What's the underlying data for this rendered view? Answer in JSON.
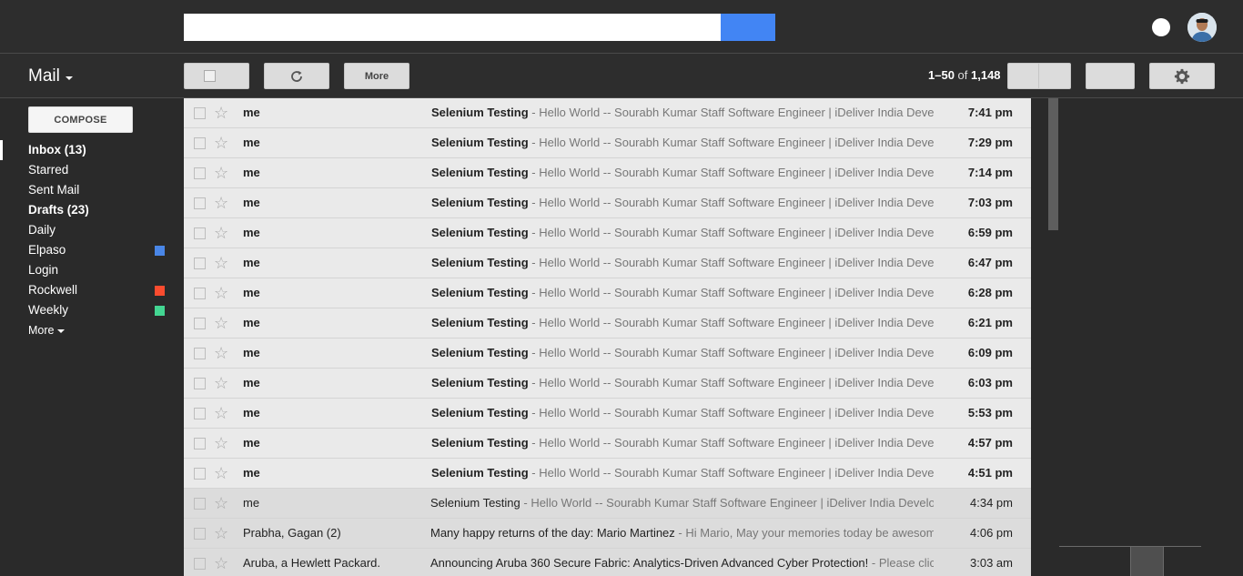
{
  "header": {
    "search_placeholder": "",
    "search_value": ""
  },
  "toolbar": {
    "mail_label": "Mail",
    "more_label": "More",
    "pager_range": "1–50",
    "pager_of": " of ",
    "pager_total": "1,148"
  },
  "sidebar": {
    "compose_label": "COMPOSE",
    "items": [
      {
        "label": "Inbox (13)",
        "bold": true,
        "active": true,
        "color": null
      },
      {
        "label": "Starred",
        "bold": false,
        "active": false,
        "color": null
      },
      {
        "label": "Sent Mail",
        "bold": false,
        "active": false,
        "color": null
      },
      {
        "label": "Drafts (23)",
        "bold": true,
        "active": false,
        "color": null
      },
      {
        "label": "Daily",
        "bold": false,
        "active": false,
        "color": null
      },
      {
        "label": "Elpaso",
        "bold": false,
        "active": false,
        "color": "#4986e7"
      },
      {
        "label": "Login",
        "bold": false,
        "active": false,
        "color": null
      },
      {
        "label": "Rockwell",
        "bold": false,
        "active": false,
        "color": "#fb4c2f"
      },
      {
        "label": "Weekly",
        "bold": false,
        "active": false,
        "color": "#43d692"
      }
    ],
    "more_label": "More"
  },
  "emails": [
    {
      "sender": "me",
      "subject": "Selenium Testing",
      "snippet": " - Hello World -- Sourabh Kumar Staff Software Engineer | iDeliver India Develo",
      "time": "7:41 pm",
      "unread": true
    },
    {
      "sender": "me",
      "subject": "Selenium Testing",
      "snippet": " - Hello World -- Sourabh Kumar Staff Software Engineer | iDeliver India Develo",
      "time": "7:29 pm",
      "unread": true
    },
    {
      "sender": "me",
      "subject": "Selenium Testing",
      "snippet": " - Hello World -- Sourabh Kumar Staff Software Engineer | iDeliver India Develo",
      "time": "7:14 pm",
      "unread": true
    },
    {
      "sender": "me",
      "subject": "Selenium Testing",
      "snippet": " - Hello World -- Sourabh Kumar Staff Software Engineer | iDeliver India Develo",
      "time": "7:03 pm",
      "unread": true
    },
    {
      "sender": "me",
      "subject": "Selenium Testing",
      "snippet": " - Hello World -- Sourabh Kumar Staff Software Engineer | iDeliver India Develo",
      "time": "6:59 pm",
      "unread": true
    },
    {
      "sender": "me",
      "subject": "Selenium Testing",
      "snippet": " - Hello World -- Sourabh Kumar Staff Software Engineer | iDeliver India Develo",
      "time": "6:47 pm",
      "unread": true
    },
    {
      "sender": "me",
      "subject": "Selenium Testing",
      "snippet": " - Hello World -- Sourabh Kumar Staff Software Engineer | iDeliver India Develo",
      "time": "6:28 pm",
      "unread": true
    },
    {
      "sender": "me",
      "subject": "Selenium Testing",
      "snippet": " - Hello World -- Sourabh Kumar Staff Software Engineer | iDeliver India Develo",
      "time": "6:21 pm",
      "unread": true
    },
    {
      "sender": "me",
      "subject": "Selenium Testing",
      "snippet": " - Hello World -- Sourabh Kumar Staff Software Engineer | iDeliver India Develo",
      "time": "6:09 pm",
      "unread": true
    },
    {
      "sender": "me",
      "subject": "Selenium Testing",
      "snippet": " - Hello World -- Sourabh Kumar Staff Software Engineer | iDeliver India Develo",
      "time": "6:03 pm",
      "unread": true
    },
    {
      "sender": "me",
      "subject": "Selenium Testing",
      "snippet": " - Hello World -- Sourabh Kumar Staff Software Engineer | iDeliver India Develo",
      "time": "5:53 pm",
      "unread": true
    },
    {
      "sender": "me",
      "subject": "Selenium Testing",
      "snippet": " - Hello World -- Sourabh Kumar Staff Software Engineer | iDeliver India Develo",
      "time": "4:57 pm",
      "unread": true
    },
    {
      "sender": "me",
      "subject": "Selenium Testing",
      "snippet": " - Hello World -- Sourabh Kumar Staff Software Engineer | iDeliver India Develo",
      "time": "4:51 pm",
      "unread": true
    },
    {
      "sender": "me",
      "subject": "Selenium Testing",
      "snippet": " - Hello World -- Sourabh Kumar Staff Software Engineer | iDeliver India Develop",
      "time": "4:34 pm",
      "unread": false
    },
    {
      "sender": "Prabha, Gagan (2)",
      "subject": "Many happy returns of the day: Mario Martinez",
      "snippet": " - Hi Mario, May your memories today be awesome",
      "time": "4:06 pm",
      "unread": false
    },
    {
      "sender": "Aruba, a Hewlett Packard.",
      "subject": "Announcing Aruba 360 Secure Fabric: Analytics-Driven Advanced Cyber Protection!",
      "snippet": " - Please click",
      "time": "3:03 am",
      "unread": false
    }
  ],
  "icons": {
    "checkbox": "checkbox-icon",
    "refresh": "refresh-icon",
    "star": "star-icon",
    "settings": "gear-icon",
    "caret": "chevron-down-icon"
  },
  "colors": {
    "search_button": "#4285f4",
    "background": "#2a2a2a"
  }
}
